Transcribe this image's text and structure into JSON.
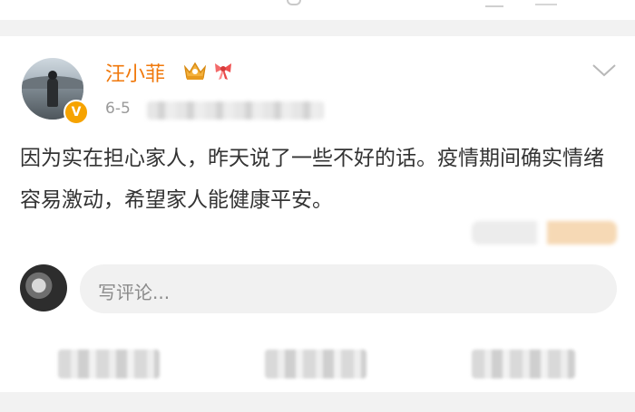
{
  "post": {
    "author": "汪小菲",
    "verified_badge": "V",
    "date": "6-5",
    "text": "因为实在担心家人，昨天说了一些不好的话。疫情期间确实情绪容易激动，希望家人能健康平安。"
  },
  "comment": {
    "placeholder": "写评论..."
  },
  "icons": {
    "crown": "crown-icon",
    "bow": "bow-icon",
    "chevron": "chevron-down-icon"
  },
  "colors": {
    "username": "#f0780b",
    "verified": "#f6a300",
    "text": "#333333",
    "meta": "#9a9a9a"
  }
}
